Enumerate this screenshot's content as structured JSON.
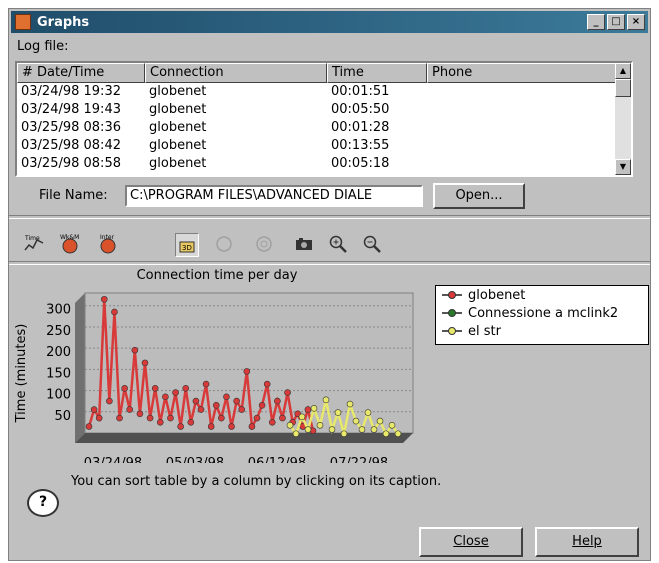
{
  "window": {
    "title": "Graphs",
    "buttons": [
      "_",
      "□",
      "×"
    ]
  },
  "log": {
    "label": "Log file:",
    "columns": [
      "# Date/Time",
      "Connection",
      "Time",
      "Phone"
    ],
    "rows": [
      [
        "03/24/98 19:32",
        "globenet",
        "00:01:51",
        ""
      ],
      [
        "03/24/98 19:43",
        "globenet",
        "00:05:50",
        ""
      ],
      [
        "03/25/98 08:36",
        "globenet",
        "00:01:28",
        ""
      ],
      [
        "03/25/98 08:42",
        "globenet",
        "00:13:55",
        ""
      ],
      [
        "03/25/98 08:58",
        "globenet",
        "00:05:18",
        ""
      ]
    ]
  },
  "file": {
    "label": "File Name:",
    "value": "C:\\PROGRAM FILES\\ADVANCED DIALE",
    "open_label": "Open..."
  },
  "toolbar": {
    "icons": [
      "time-graph-icon",
      "graph-icon-2",
      "graph-icon-3",
      "3d-toggle-icon",
      "disabled-icon-1",
      "disabled-icon-2",
      "camera-icon",
      "zoom-in-icon",
      "zoom-out-icon"
    ],
    "labels": [
      "Time",
      "Wk&M",
      "Inter",
      "3D"
    ]
  },
  "chart_data": {
    "type": "line",
    "title": "Connection time per day",
    "ylabel": "Time (minutes)",
    "xlabel": "",
    "yticks": [
      50,
      100,
      150,
      200,
      250,
      300
    ],
    "ylim": [
      0,
      330
    ],
    "xticks": [
      "03/24/98",
      "05/03/98",
      "06/12/98",
      "07/22/98"
    ],
    "grid": true,
    "three_d": true,
    "legend_position": "right",
    "series": [
      {
        "name": "globenet",
        "color": "#d83a3a",
        "values": [
          20,
          60,
          40,
          320,
          80,
          290,
          40,
          110,
          60,
          200,
          50,
          170,
          40,
          110,
          30,
          90,
          40,
          100,
          20,
          110,
          30,
          80,
          60,
          120,
          20,
          70,
          40,
          90,
          20,
          80,
          60,
          150,
          20,
          40,
          70,
          120,
          30,
          80,
          40,
          100,
          30,
          50,
          20,
          60,
          10
        ]
      },
      {
        "name": "Connessione a mclink2",
        "color": "#2a7a2a",
        "values": []
      },
      {
        "name": "el str",
        "color": "#e8e86a",
        "values": [
          30,
          10,
          50,
          20,
          70,
          30,
          90,
          20,
          60,
          10,
          80,
          40,
          20,
          60,
          20,
          40,
          10,
          30,
          10
        ]
      }
    ]
  },
  "hint": {
    "text": "You can sort table by a column by clicking on its caption."
  },
  "footer": {
    "close_label": "Close",
    "help_label": "Help"
  }
}
